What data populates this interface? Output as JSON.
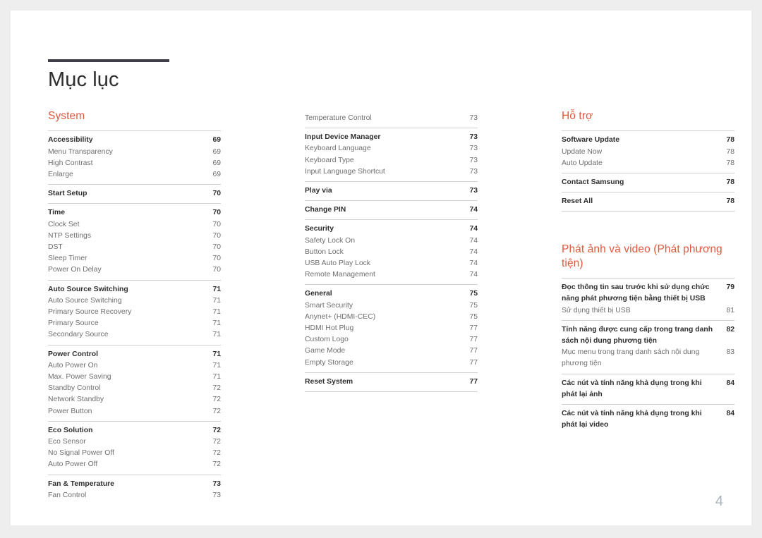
{
  "document": {
    "title": "Mục lục",
    "page_number": "4",
    "accent_color": "#e0573e",
    "rule_color": "#3e3d4a",
    "page_number_color": "#a9b4bf"
  },
  "columns": [
    {
      "name": "column-1",
      "sections": [
        {
          "heading": "System",
          "groups": [
            {
              "entries": [
                {
                  "label": "Accessibility",
                  "page": "69",
                  "primary": true
                },
                {
                  "label": "Menu Transparency",
                  "page": "69",
                  "primary": false
                },
                {
                  "label": "High Contrast",
                  "page": "69",
                  "primary": false
                },
                {
                  "label": "Enlarge",
                  "page": "69",
                  "primary": false
                }
              ]
            },
            {
              "entries": [
                {
                  "label": "Start Setup",
                  "page": "70",
                  "primary": true
                }
              ]
            },
            {
              "entries": [
                {
                  "label": "Time",
                  "page": "70",
                  "primary": true
                },
                {
                  "label": "Clock Set",
                  "page": "70",
                  "primary": false
                },
                {
                  "label": "NTP Settings",
                  "page": "70",
                  "primary": false
                },
                {
                  "label": "DST",
                  "page": "70",
                  "primary": false
                },
                {
                  "label": "Sleep Timer",
                  "page": "70",
                  "primary": false
                },
                {
                  "label": "Power On Delay",
                  "page": "70",
                  "primary": false
                }
              ]
            },
            {
              "entries": [
                {
                  "label": "Auto Source Switching",
                  "page": "71",
                  "primary": true
                },
                {
                  "label": "Auto Source Switching",
                  "page": "71",
                  "primary": false
                },
                {
                  "label": "Primary Source Recovery",
                  "page": "71",
                  "primary": false
                },
                {
                  "label": "Primary Source",
                  "page": "71",
                  "primary": false
                },
                {
                  "label": "Secondary Source",
                  "page": "71",
                  "primary": false
                }
              ]
            },
            {
              "entries": [
                {
                  "label": "Power Control",
                  "page": "71",
                  "primary": true
                },
                {
                  "label": "Auto Power On",
                  "page": "71",
                  "primary": false
                },
                {
                  "label": "Max. Power Saving",
                  "page": "71",
                  "primary": false
                },
                {
                  "label": "Standby Control",
                  "page": "72",
                  "primary": false
                },
                {
                  "label": "Network Standby",
                  "page": "72",
                  "primary": false
                },
                {
                  "label": "Power Button",
                  "page": "72",
                  "primary": false
                }
              ]
            },
            {
              "entries": [
                {
                  "label": "Eco Solution",
                  "page": "72",
                  "primary": true
                },
                {
                  "label": "Eco Sensor",
                  "page": "72",
                  "primary": false
                },
                {
                  "label": "No Signal Power Off",
                  "page": "72",
                  "primary": false
                },
                {
                  "label": "Auto Power Off",
                  "page": "72",
                  "primary": false
                }
              ]
            },
            {
              "entries": [
                {
                  "label": "Fan & Temperature",
                  "page": "73",
                  "primary": true
                },
                {
                  "label": "Fan Control",
                  "page": "73",
                  "primary": false
                }
              ]
            }
          ]
        }
      ]
    },
    {
      "name": "column-2",
      "sections": [
        {
          "heading": "",
          "groups": [
            {
              "no_rule": true,
              "entries": [
                {
                  "label": "Temperature Control",
                  "page": "73",
                  "primary": false
                }
              ]
            },
            {
              "entries": [
                {
                  "label": "Input Device Manager",
                  "page": "73",
                  "primary": true
                },
                {
                  "label": "Keyboard Language",
                  "page": "73",
                  "primary": false
                },
                {
                  "label": "Keyboard Type",
                  "page": "73",
                  "primary": false
                },
                {
                  "label": "Input Language Shortcut",
                  "page": "73",
                  "primary": false
                }
              ]
            },
            {
              "entries": [
                {
                  "label": "Play via",
                  "page": "73",
                  "primary": true
                }
              ]
            },
            {
              "entries": [
                {
                  "label": "Change PIN",
                  "page": "74",
                  "primary": true
                }
              ]
            },
            {
              "entries": [
                {
                  "label": "Security",
                  "page": "74",
                  "primary": true
                },
                {
                  "label": "Safety Lock On",
                  "page": "74",
                  "primary": false
                },
                {
                  "label": "Button Lock",
                  "page": "74",
                  "primary": false
                },
                {
                  "label": "USB Auto Play Lock",
                  "page": "74",
                  "primary": false
                },
                {
                  "label": "Remote Management",
                  "page": "74",
                  "primary": false
                }
              ]
            },
            {
              "entries": [
                {
                  "label": "General",
                  "page": "75",
                  "primary": true
                },
                {
                  "label": "Smart Security",
                  "page": "75",
                  "primary": false
                },
                {
                  "label": "Anynet+ (HDMI-CEC)",
                  "page": "75",
                  "primary": false
                },
                {
                  "label": "HDMI Hot Plug",
                  "page": "77",
                  "primary": false
                },
                {
                  "label": "Custom Logo",
                  "page": "77",
                  "primary": false
                },
                {
                  "label": "Game Mode",
                  "page": "77",
                  "primary": false
                },
                {
                  "label": "Empty Storage",
                  "page": "77",
                  "primary": false
                }
              ]
            },
            {
              "last": true,
              "entries": [
                {
                  "label": "Reset System",
                  "page": "77",
                  "primary": true
                }
              ]
            }
          ]
        }
      ]
    },
    {
      "name": "column-3",
      "sections": [
        {
          "heading": "Hỗ trợ",
          "groups": [
            {
              "entries": [
                {
                  "label": "Software Update",
                  "page": "78",
                  "primary": true
                },
                {
                  "label": "Update Now",
                  "page": "78",
                  "primary": false
                },
                {
                  "label": "Auto Update",
                  "page": "78",
                  "primary": false
                }
              ]
            },
            {
              "entries": [
                {
                  "label": "Contact Samsung",
                  "page": "78",
                  "primary": true
                }
              ]
            },
            {
              "last": true,
              "entries": [
                {
                  "label": "Reset All",
                  "page": "78",
                  "primary": true
                }
              ]
            }
          ]
        },
        {
          "heading": "Phát ảnh và video (Phát phương tiện)",
          "spaced": true,
          "groups": [
            {
              "entries": [
                {
                  "label": "Đọc thông tin sau trước khi sử dụng chức năng phát phương tiện bằng thiết bị USB",
                  "page": "79",
                  "primary": true,
                  "wrap": true
                },
                {
                  "label": "Sử dụng thiết bị USB",
                  "page": "81",
                  "primary": false
                }
              ]
            },
            {
              "entries": [
                {
                  "label": "Tính năng được cung cấp trong trang danh sách nội dung phương tiện",
                  "page": "82",
                  "primary": true,
                  "wrap": true
                },
                {
                  "label": "Mục menu trong trang danh sách nội dung phương tiện",
                  "page": "83",
                  "primary": false,
                  "wrap": true
                }
              ]
            },
            {
              "entries": [
                {
                  "label": "Các nút và tính năng khả dụng trong khi phát lại ảnh",
                  "page": "84",
                  "primary": true,
                  "wrap": true
                }
              ]
            },
            {
              "entries": [
                {
                  "label": "Các nút và tính năng khả dụng trong khi phát lại video",
                  "page": "84",
                  "primary": true,
                  "wrap": true
                }
              ]
            }
          ]
        }
      ]
    }
  ]
}
